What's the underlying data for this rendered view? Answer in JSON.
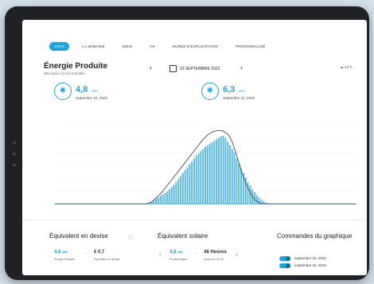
{
  "tabs": [
    "JOUR",
    "LA SEMAINE",
    "MOIS",
    "AN",
    "DURÉE D'EXPLOITATION",
    "PERSONNALISÉ"
  ],
  "title": "Énergie Produite",
  "subtitle": "Mis à jour il y a 5 minutes",
  "date": "23 SEPTEMBRE 2022",
  "temperature": "14°C",
  "stats": [
    {
      "value": "4,8",
      "unit": "kWh",
      "date": "septembre 23, 2022"
    },
    {
      "value": "6,3",
      "unit": "kWh",
      "date": "septembre 22, 2022"
    }
  ],
  "currency": {
    "title": "Équivalent en devise",
    "produced": "4,8",
    "produced_unit": "kWh",
    "produced_label": "Énergie Produite",
    "money": "€ 0,7",
    "money_label": "Équivalent en devise"
  },
  "solar": {
    "title": "Équivalent solaire",
    "produced": "4,8",
    "produced_unit": "kWh",
    "produced_label": "Produit solaire",
    "hours": "48 Heures",
    "hours_label": "Ampoule 100 W"
  },
  "legend": {
    "title": "Commandes du graphique",
    "items": [
      "septembre 23, 2022",
      "septembre 22, 2022"
    ]
  },
  "chart_data": {
    "type": "bar",
    "series": [
      {
        "name": "septembre 23, 2022",
        "kind": "bar",
        "values": [
          0,
          0,
          0,
          0,
          0,
          0,
          0,
          0,
          0,
          0,
          0,
          0,
          0,
          0,
          0,
          0,
          0,
          0,
          0,
          0,
          0,
          0,
          0,
          0,
          0,
          0,
          0,
          0,
          0,
          0,
          0,
          0,
          0,
          0,
          0,
          0,
          0,
          0,
          0,
          0,
          0,
          0.01,
          0.02,
          0.03,
          0.05,
          0.07,
          0.09,
          0.11,
          0.13,
          0.15,
          0.17,
          0.2,
          0.23,
          0.26,
          0.3,
          0.34,
          0.38,
          0.42,
          0.46,
          0.5,
          0.54,
          0.58,
          0.62,
          0.66,
          0.69,
          0.72,
          0.75,
          0.78,
          0.8,
          0.82,
          0.84,
          0.86,
          0.88,
          0.9,
          0.92,
          0.93,
          0.9,
          0.85,
          0.8,
          0.75,
          0.7,
          0.62,
          0.55,
          0.48,
          0.42,
          0.36,
          0.3,
          0.25,
          0.2,
          0.16,
          0.12,
          0.09,
          0.06,
          0.04,
          0.02,
          0.01,
          0,
          0,
          0,
          0,
          0,
          0,
          0,
          0,
          0,
          0,
          0,
          0,
          0,
          0,
          0,
          0,
          0,
          0,
          0,
          0,
          0,
          0,
          0,
          0,
          0,
          0,
          0,
          0,
          0,
          0,
          0,
          0,
          0,
          0,
          0,
          0,
          0,
          0,
          0
        ]
      },
      {
        "name": "septembre 22, 2022",
        "kind": "line",
        "values": [
          0,
          0,
          0,
          0,
          0,
          0,
          0,
          0,
          0,
          0,
          0,
          0,
          0,
          0,
          0,
          0,
          0,
          0,
          0,
          0,
          0,
          0,
          0,
          0,
          0,
          0,
          0,
          0,
          0,
          0,
          0,
          0,
          0,
          0,
          0,
          0,
          0,
          0,
          0,
          0,
          0,
          0.01,
          0.02,
          0.04,
          0.07,
          0.1,
          0.13,
          0.16,
          0.2,
          0.24,
          0.28,
          0.32,
          0.36,
          0.4,
          0.44,
          0.48,
          0.52,
          0.56,
          0.6,
          0.64,
          0.68,
          0.72,
          0.76,
          0.8,
          0.84,
          0.88,
          0.91,
          0.94,
          0.96,
          0.98,
          0.99,
          1.0,
          1.0,
          1.0,
          0.99,
          0.97,
          0.95,
          0.9,
          0.83,
          0.74,
          0.64,
          0.54,
          0.44,
          0.35,
          0.27,
          0.2,
          0.14,
          0.09,
          0.05,
          0.03,
          0.01,
          0,
          0,
          0,
          0,
          0,
          0,
          0,
          0,
          0,
          0,
          0,
          0,
          0,
          0,
          0,
          0,
          0,
          0,
          0,
          0,
          0,
          0,
          0,
          0,
          0,
          0,
          0,
          0,
          0,
          0,
          0,
          0,
          0,
          0,
          0,
          0,
          0,
          0,
          0,
          0,
          0,
          0
        ]
      }
    ],
    "ylim": [
      0,
      1.05
    ]
  }
}
